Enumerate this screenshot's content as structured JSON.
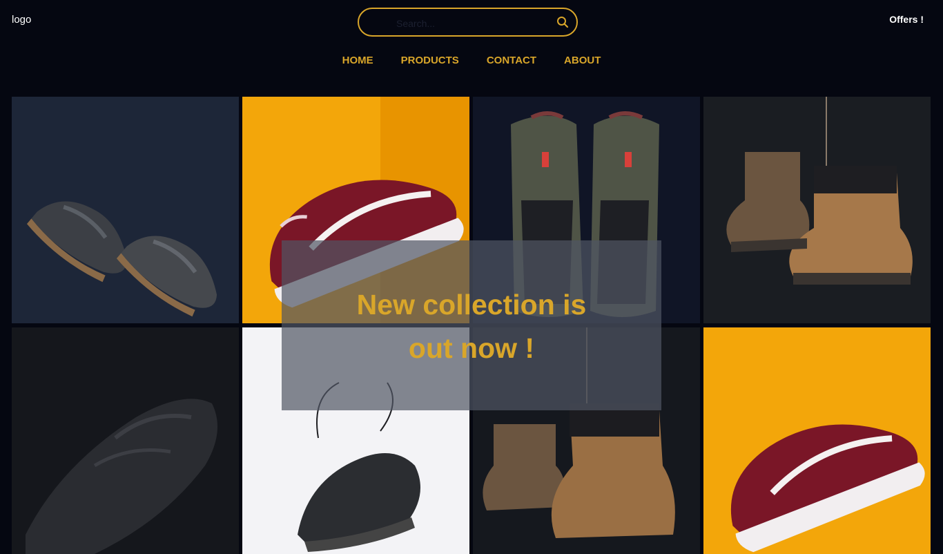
{
  "header": {
    "logo_text": "logo",
    "offers_label": "Offers !",
    "search": {
      "placeholder": "Search..."
    }
  },
  "nav": {
    "items": [
      {
        "label": "HOME"
      },
      {
        "label": "PRODUCTS"
      },
      {
        "label": "CONTACT"
      },
      {
        "label": "ABOUT"
      }
    ]
  },
  "gallery": {
    "tiles": [
      {
        "image": "grey-sneakers-pair"
      },
      {
        "image": "burgundy-skate-shoe-on-yellow"
      },
      {
        "image": "olive-high-top-sneakers"
      },
      {
        "image": "tan-work-boots-hanging"
      },
      {
        "image": "black-knit-sneaker"
      },
      {
        "image": "black-running-shoe-on-white"
      },
      {
        "image": "tan-work-boots-hanging"
      },
      {
        "image": "burgundy-skate-shoe-on-yellow"
      }
    ]
  },
  "hero": {
    "line1": "New collection is",
    "line2": "out now !"
  },
  "colors": {
    "background": "#050711",
    "accent": "#d9a62a",
    "text": "#ffffff"
  }
}
